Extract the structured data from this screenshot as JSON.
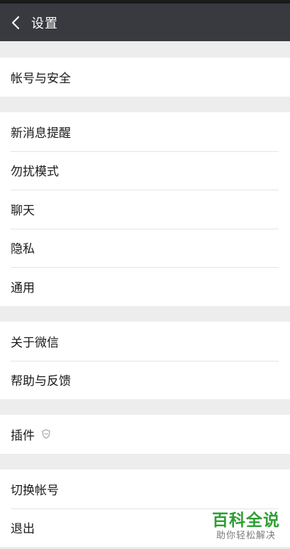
{
  "header": {
    "title": "设置"
  },
  "groups": [
    {
      "items": [
        {
          "label": "帐号与安全"
        }
      ]
    },
    {
      "items": [
        {
          "label": "新消息提醒"
        },
        {
          "label": "勿扰模式"
        },
        {
          "label": "聊天"
        },
        {
          "label": "隐私"
        },
        {
          "label": "通用"
        }
      ]
    },
    {
      "items": [
        {
          "label": "关于微信"
        },
        {
          "label": "帮助与反馈"
        }
      ]
    },
    {
      "items": [
        {
          "label": "插件",
          "icon": "shield-icon"
        }
      ]
    },
    {
      "items": [
        {
          "label": "切换帐号"
        },
        {
          "label": "退出"
        }
      ]
    }
  ],
  "watermark": {
    "title": "百科全说",
    "subtitle": "助你轻松解决"
  },
  "colors": {
    "header_bg": "#393a3f",
    "page_bg": "#ededed",
    "row_bg": "#ffffff",
    "watermark_green": "#2f9e32"
  }
}
